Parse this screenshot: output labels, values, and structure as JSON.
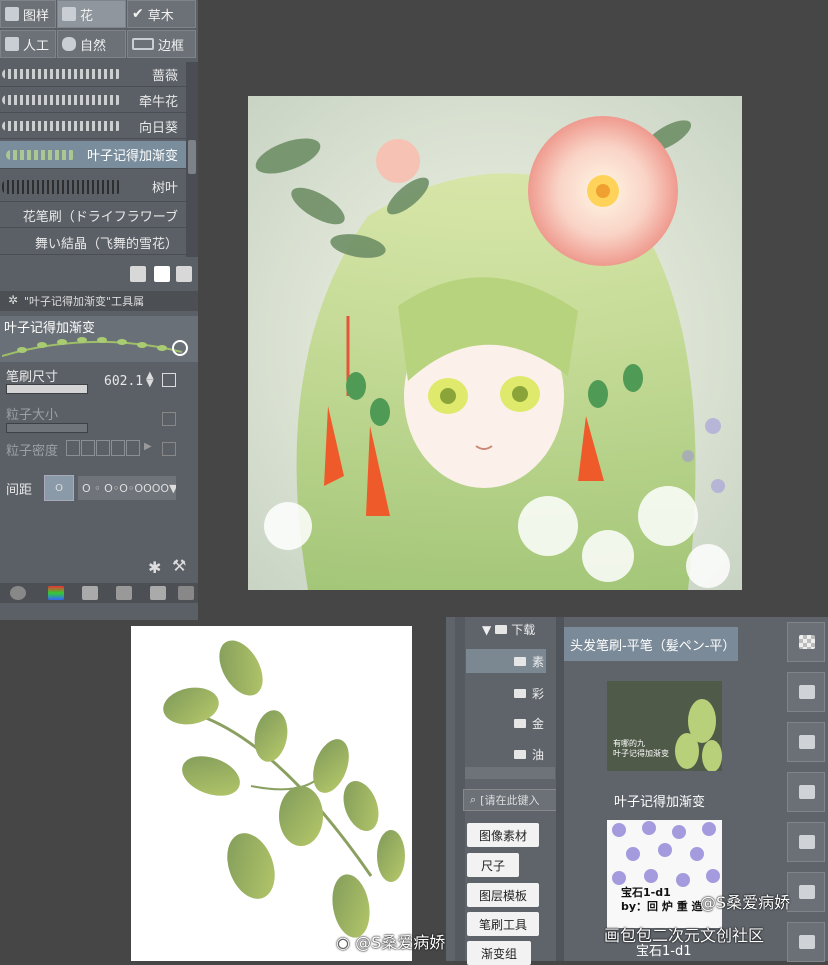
{
  "brush_panel": {
    "category_tabs": [
      {
        "label": "图样",
        "icon": "pattern-icon"
      },
      {
        "label": "花",
        "icon": "flower-icon"
      },
      {
        "label": "草木",
        "icon": "check-icon"
      },
      {
        "label": "人工",
        "icon": "wrench-icon"
      },
      {
        "label": "自然",
        "icon": "rock-icon"
      },
      {
        "label": "边框",
        "icon": "border-icon"
      }
    ],
    "brushes": [
      "蔷薇",
      "牵牛花",
      "向日葵",
      "叶子记得加渐变",
      "树叶",
      "花笔刷（ドライフラワーブ",
      "舞い結晶（飞舞的雪花）"
    ],
    "selected_brush": "叶子记得加渐变",
    "tool_property_title": "\"叶子记得加渐变\"工具属",
    "preview_name": "叶子记得加渐变",
    "brush_size_label": "笔刷尺寸",
    "brush_size_value": "602.1",
    "particle_size_label": "粒子大小",
    "particle_density_label": "粒子密度",
    "spacing_label": "间距",
    "spacing_options": "O ◦ O◦O◦OOOO"
  },
  "material_panel": {
    "tree_root": "下载",
    "tree_items": [
      "素",
      "彩",
      "金",
      "油"
    ],
    "search_placeholder": "[请在此键入",
    "category_buttons": [
      "图像素材",
      "尺子",
      "图层模板",
      "笔刷工具",
      "渐变组"
    ],
    "material_title": "头发笔刷-平笔（髪ペン-平）",
    "thumb1_caption": "有哪的九\n叶子记得加渐变",
    "material_name_1": "叶子记得加渐变",
    "thumb2_caption": "宝石1-d1\nby：回 炉 重 造",
    "material_name_2": "宝石1-d1"
  },
  "watermarks": {
    "center": "@S桑爱病娇",
    "right_top": "@S桑爱病娇",
    "right_bottom": "画包包二次元文创社区"
  },
  "colors": {
    "panel_bg": "#5b6067",
    "canvas_bg": "#464646",
    "selection": "#7a8d9c"
  }
}
